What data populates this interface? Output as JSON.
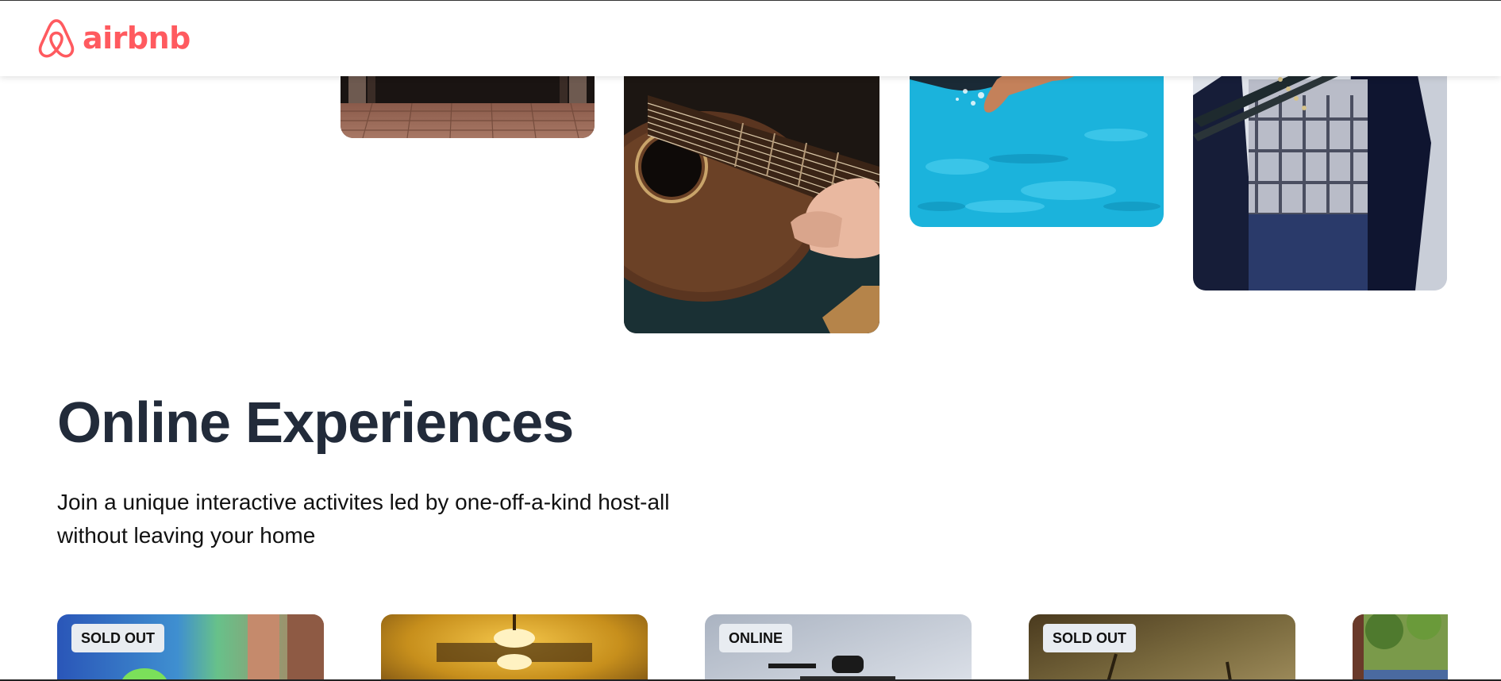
{
  "header": {
    "logo_text": "airbnb",
    "brand_color": "#FF5A5F",
    "logo_icon": "airbnb-belo-icon"
  },
  "hero_photos": [
    {
      "name": "doorway-photo",
      "subject": "brick-floor-doorway"
    },
    {
      "name": "guitar-photo",
      "subject": "acoustic-guitar"
    },
    {
      "name": "swimmer-photo",
      "subject": "swimmer-pool"
    },
    {
      "name": "musician-photo",
      "subject": "musician-jacket"
    }
  ],
  "online_experiences": {
    "title": "Online Experiences",
    "description": "Join a unique interactive activites led by one-off-a-kind host-all without leaving your home",
    "title_color": "#222b3a"
  },
  "cards": [
    {
      "badge": "SOLD OUT"
    },
    {
      "badge": ""
    },
    {
      "badge": "ONLINE"
    },
    {
      "badge": "SOLD OUT"
    },
    {
      "badge": ""
    }
  ]
}
